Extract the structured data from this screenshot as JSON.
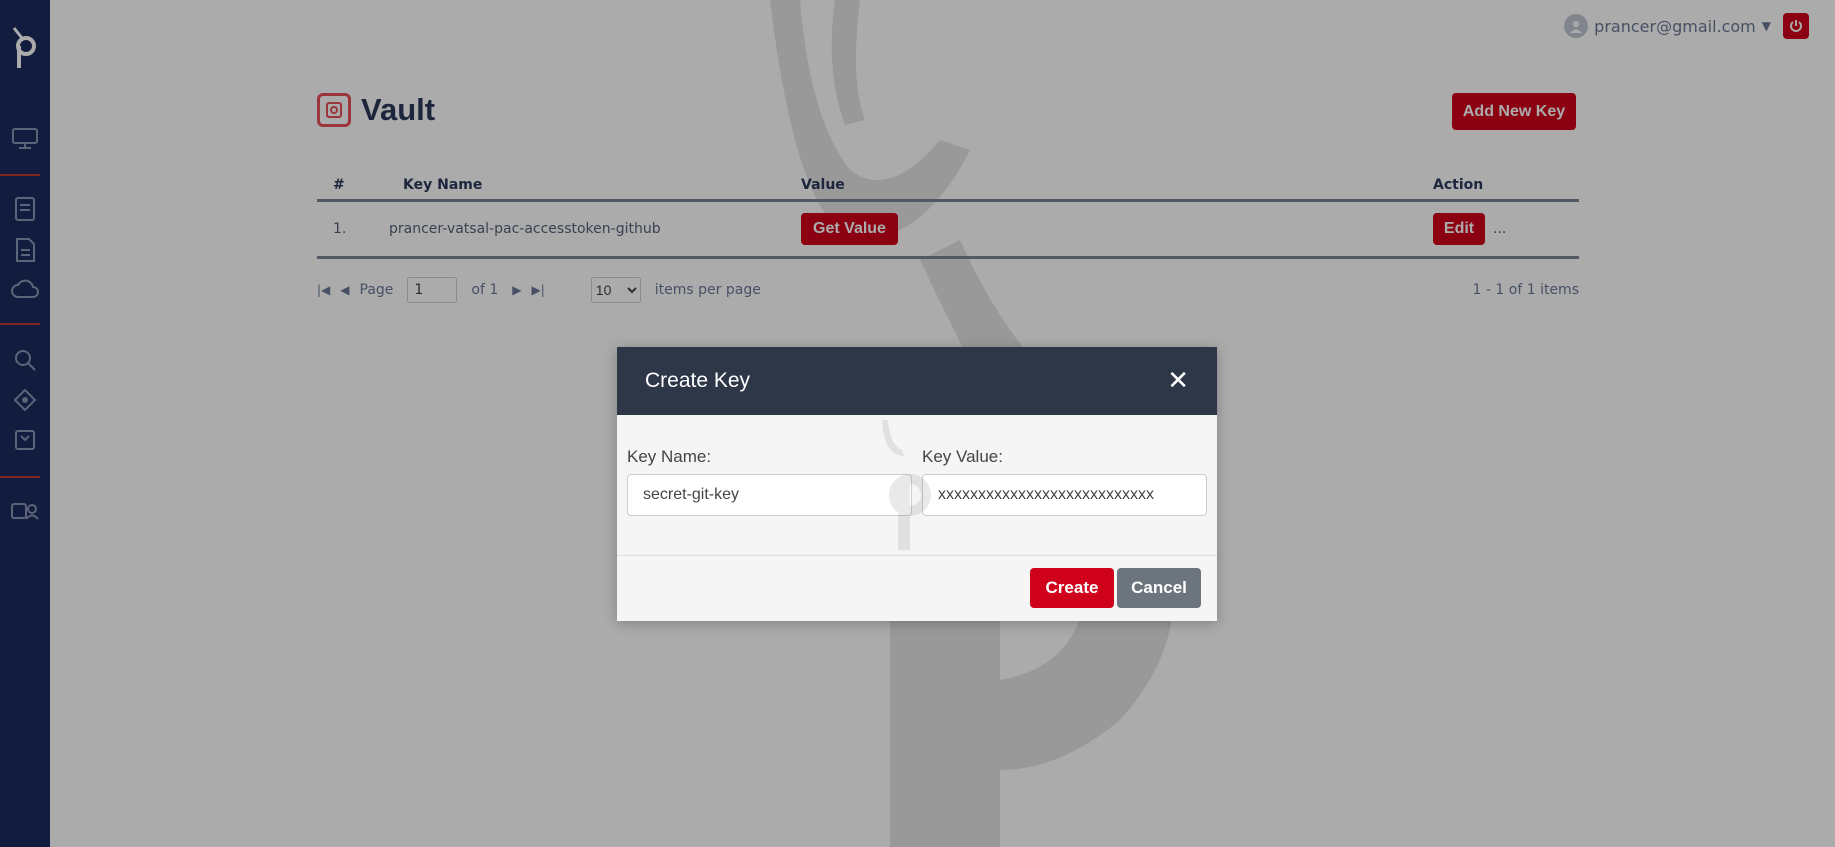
{
  "colors": {
    "sidebar": "#1b2a5e",
    "accent": "#d0021b",
    "modal_header": "#2d3748",
    "cancel": "#6c757d"
  },
  "sidebar": {
    "logo": "prancer-logo-icon",
    "items": [
      {
        "icon": "dashboard-icon"
      },
      {
        "icon": "document-icon"
      },
      {
        "icon": "report-icon"
      },
      {
        "icon": "cloud-icon"
      },
      {
        "icon": "search-icon"
      },
      {
        "icon": "settings-icon"
      },
      {
        "icon": "vault-icon"
      },
      {
        "icon": "users-icon"
      }
    ]
  },
  "header": {
    "user_email": "prancer@gmail.com"
  },
  "page": {
    "title": "Vault",
    "add_button": "Add New Key"
  },
  "table": {
    "columns": [
      "#",
      "Key Name",
      "Value",
      "Action"
    ],
    "rows": [
      {
        "num": "1.",
        "name": "prancer-vatsal-pac-accesstoken-github",
        "value_button": "Get Value",
        "action_button": "Edit",
        "more": "..."
      }
    ]
  },
  "pagination": {
    "page_label": "Page",
    "current_page": "1",
    "of_label": "of 1",
    "per_page": "10",
    "per_page_label": "items per page",
    "range": "1 - 1 of 1 items"
  },
  "modal": {
    "title": "Create Key",
    "key_name_label": "Key Name:",
    "key_name_value": "secret-git-key",
    "key_value_label": "Key Value:",
    "key_value_value": "xxxxxxxxxxxxxxxxxxxxxxxxxxx",
    "create_label": "Create",
    "cancel_label": "Cancel"
  }
}
